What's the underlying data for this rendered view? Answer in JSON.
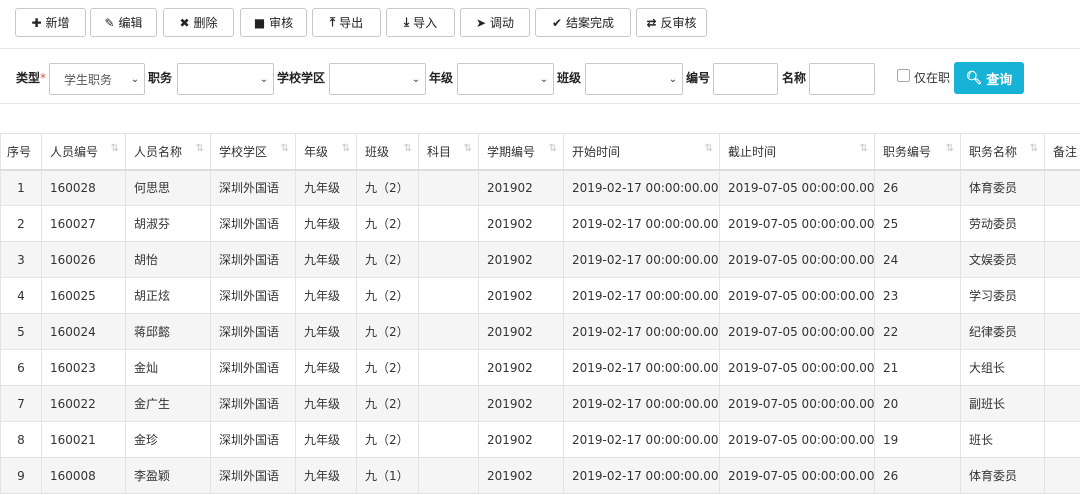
{
  "toolbar": {
    "buttons": [
      {
        "label": "新增",
        "icon": "plus-icon",
        "glyph": "✚"
      },
      {
        "label": "编辑",
        "icon": "pencil-icon",
        "glyph": "✎"
      },
      {
        "label": "删除",
        "icon": "close-icon",
        "glyph": "✖"
      },
      {
        "label": "审核",
        "icon": "lock-icon",
        "glyph": "🔒"
      },
      {
        "label": "导出",
        "icon": "export-icon",
        "glyph": "⭱"
      },
      {
        "label": "导入",
        "icon": "import-icon",
        "glyph": "⭳"
      },
      {
        "label": "调动",
        "icon": "send-icon",
        "glyph": "➤"
      },
      {
        "label": "结案完成",
        "icon": "check-icon",
        "glyph": "✔"
      },
      {
        "label": "反审核",
        "icon": "swap-icon",
        "glyph": "⇄"
      }
    ]
  },
  "filters": {
    "type_label": "类型",
    "required_mark": "*",
    "type_value": "学生职务",
    "duty_label": "职务",
    "duty_value": "",
    "district_label": "学校学区",
    "district_value": "",
    "grade_label": "年级",
    "grade_value": "",
    "class_label": "班级",
    "class_value": "",
    "code_label": "编号",
    "code_value": "",
    "name_label": "名称",
    "name_value": "",
    "only_active_label": "仅在职",
    "query_label": "查询",
    "query_icon": "search-icon"
  },
  "table": {
    "headers": [
      "序号",
      "人员编号",
      "人员名称",
      "学校学区",
      "年级",
      "班级",
      "科目",
      "学期编号",
      "开始时间",
      "截止时间",
      "职务编号",
      "职务名称",
      "备注"
    ],
    "rows": [
      [
        "1",
        "160028",
        "何思思",
        "深圳外国语",
        "九年级",
        "九（2）",
        "",
        "201902",
        "2019-02-17 00:00:00.000",
        "2019-07-05 00:00:00.000",
        "26",
        "体育委员",
        ""
      ],
      [
        "2",
        "160027",
        "胡淑芬",
        "深圳外国语",
        "九年级",
        "九（2）",
        "",
        "201902",
        "2019-02-17 00:00:00.000",
        "2019-07-05 00:00:00.000",
        "25",
        "劳动委员",
        ""
      ],
      [
        "3",
        "160026",
        "胡怡",
        "深圳外国语",
        "九年级",
        "九（2）",
        "",
        "201902",
        "2019-02-17 00:00:00.000",
        "2019-07-05 00:00:00.000",
        "24",
        "文娱委员",
        ""
      ],
      [
        "4",
        "160025",
        "胡正炫",
        "深圳外国语",
        "九年级",
        "九（2）",
        "",
        "201902",
        "2019-02-17 00:00:00.000",
        "2019-07-05 00:00:00.000",
        "23",
        "学习委员",
        ""
      ],
      [
        "5",
        "160024",
        "蒋邱懿",
        "深圳外国语",
        "九年级",
        "九（2）",
        "",
        "201902",
        "2019-02-17 00:00:00.000",
        "2019-07-05 00:00:00.000",
        "22",
        "纪律委员",
        ""
      ],
      [
        "6",
        "160023",
        "金灿",
        "深圳外国语",
        "九年级",
        "九（2）",
        "",
        "201902",
        "2019-02-17 00:00:00.000",
        "2019-07-05 00:00:00.000",
        "21",
        "大组长",
        ""
      ],
      [
        "7",
        "160022",
        "金广生",
        "深圳外国语",
        "九年级",
        "九（2）",
        "",
        "201902",
        "2019-02-17 00:00:00.000",
        "2019-07-05 00:00:00.000",
        "20",
        "副班长",
        ""
      ],
      [
        "8",
        "160021",
        "金珍",
        "深圳外国语",
        "九年级",
        "九（2）",
        "",
        "201902",
        "2019-02-17 00:00:00.000",
        "2019-07-05 00:00:00.000",
        "19",
        "班长",
        ""
      ],
      [
        "9",
        "160008",
        "李盈颖",
        "深圳外国语",
        "九年级",
        "九（1）",
        "",
        "201902",
        "2019-02-17 00:00:00.000",
        "2019-07-05 00:00:00.000",
        "26",
        "体育委员",
        ""
      ]
    ]
  },
  "colors": {
    "query_button": "#17b3d6",
    "required": "#d9534f",
    "zebra": "#f5f5f5"
  }
}
